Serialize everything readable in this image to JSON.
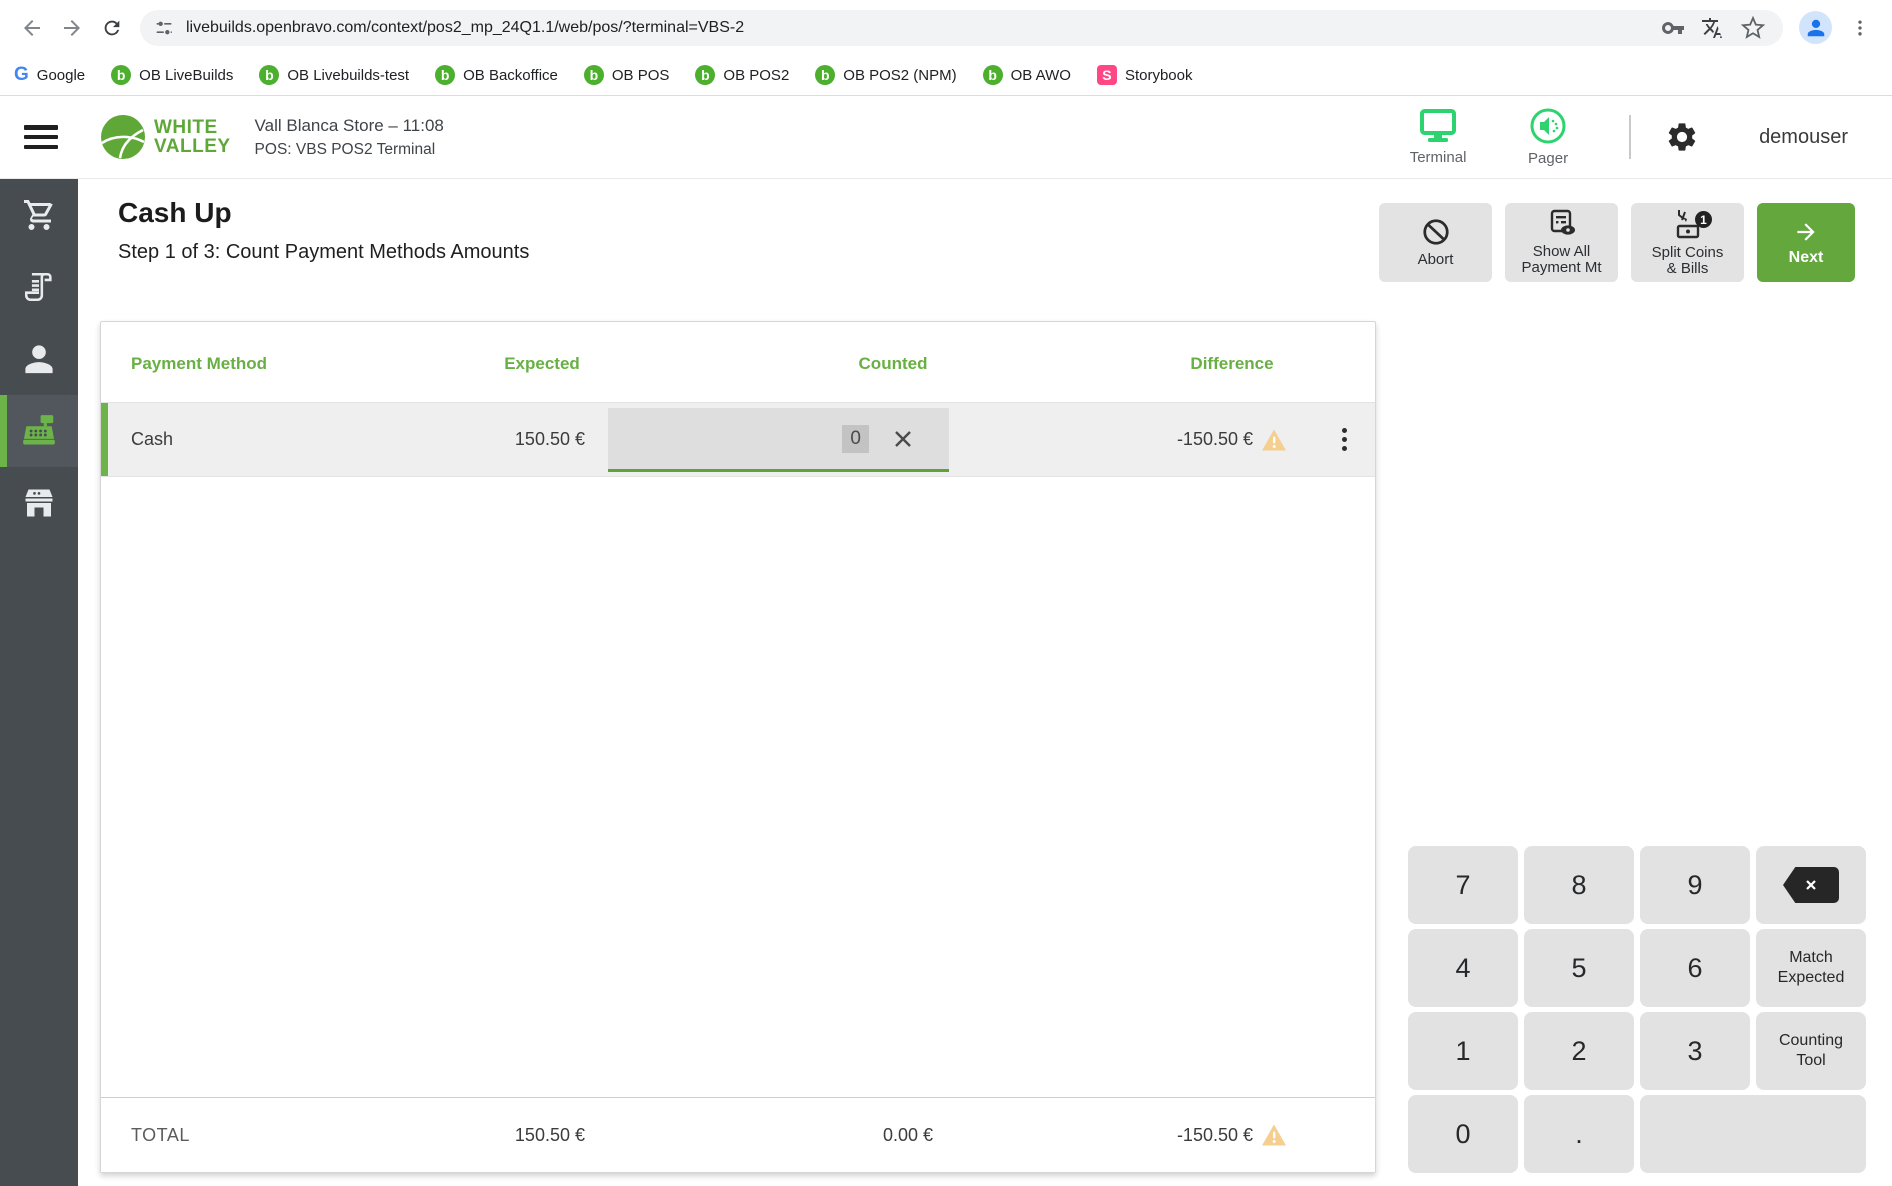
{
  "browser": {
    "url": "livebuilds.openbravo.com/context/pos2_mp_24Q1.1/web/pos/?terminal=VBS-2",
    "bookmarks": [
      {
        "label": "Google"
      },
      {
        "label": "OB LiveBuilds"
      },
      {
        "label": "OB Livebuilds-test"
      },
      {
        "label": "OB Backoffice"
      },
      {
        "label": "OB POS"
      },
      {
        "label": "OB POS2"
      },
      {
        "label": "OB POS2 (NPM)"
      },
      {
        "label": "OB AWO"
      },
      {
        "label": "Storybook"
      }
    ],
    "favicon_letters": {
      "google": "G",
      "openbravo": "b",
      "storybook": "S"
    }
  },
  "header": {
    "brand_line1": "WHITE",
    "brand_line2": "VALLEY",
    "store_line": "Vall Blanca Store – 11:08",
    "terminal_line": "POS: VBS POS2 Terminal",
    "terminal_label": "Terminal",
    "pager_label": "Pager",
    "username": "demouser"
  },
  "page": {
    "title": "Cash Up",
    "subtitle": "Step 1 of 3: Count Payment Methods Amounts"
  },
  "actions": {
    "abort": "Abort",
    "show_all_line1": "Show All",
    "show_all_line2": "Payment Mt",
    "split_line1": "Split Coins",
    "split_line2": "& Bills",
    "split_badge": "1",
    "next": "Next"
  },
  "table": {
    "headers": [
      "Payment Method",
      "Expected",
      "Counted",
      "Difference"
    ],
    "rows": [
      {
        "name": "Cash",
        "expected": "150.50 €",
        "counted": "0",
        "difference": "-150.50 €"
      }
    ],
    "total": {
      "label": "TOTAL",
      "expected": "150.50 €",
      "counted": "0.00 €",
      "difference": "-150.50 €"
    }
  },
  "numpad": {
    "keys": [
      "7",
      "8",
      "9",
      "4",
      "5",
      "6",
      "1",
      "2",
      "3",
      "0",
      "."
    ],
    "match_expected_line1": "Match",
    "match_expected_line2": "Expected",
    "counting_tool_line1": "Counting",
    "counting_tool_line2": "Tool"
  },
  "colors": {
    "brand_green": "#5fa838",
    "accent_green": "#63a73d",
    "icon_green": "#2dd36f",
    "table_header_green": "#68b043",
    "sidebar_dark": "#474c51",
    "warning_orange": "#f4cf90",
    "storybook_pink": "#ff4785"
  }
}
